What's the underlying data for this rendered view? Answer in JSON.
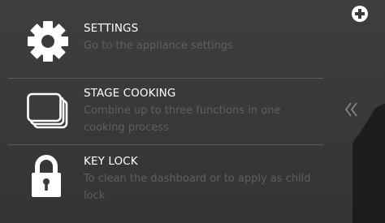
{
  "menu": {
    "items": [
      {
        "title": "SETTINGS",
        "description": "Go to the appliance settings",
        "icon": "gear-icon"
      },
      {
        "title": "STAGE COOKING",
        "description": "Combine up to three functions in one cooking process",
        "icon": "stacked-pages-icon"
      },
      {
        "title": "KEY LOCK",
        "description": "To clean the dashboard or to apply as child lock",
        "icon": "padlock-icon"
      }
    ]
  },
  "side": {
    "add_icon": "plus-circle-icon",
    "collapse_icon": "double-chevron-left-icon"
  },
  "colors": {
    "background": "#3a3a3a",
    "title_text": "#ffffff",
    "description_text": "#5f5f5f",
    "divider": "#5a5a5a",
    "side_panel": "#1c1c1c"
  }
}
